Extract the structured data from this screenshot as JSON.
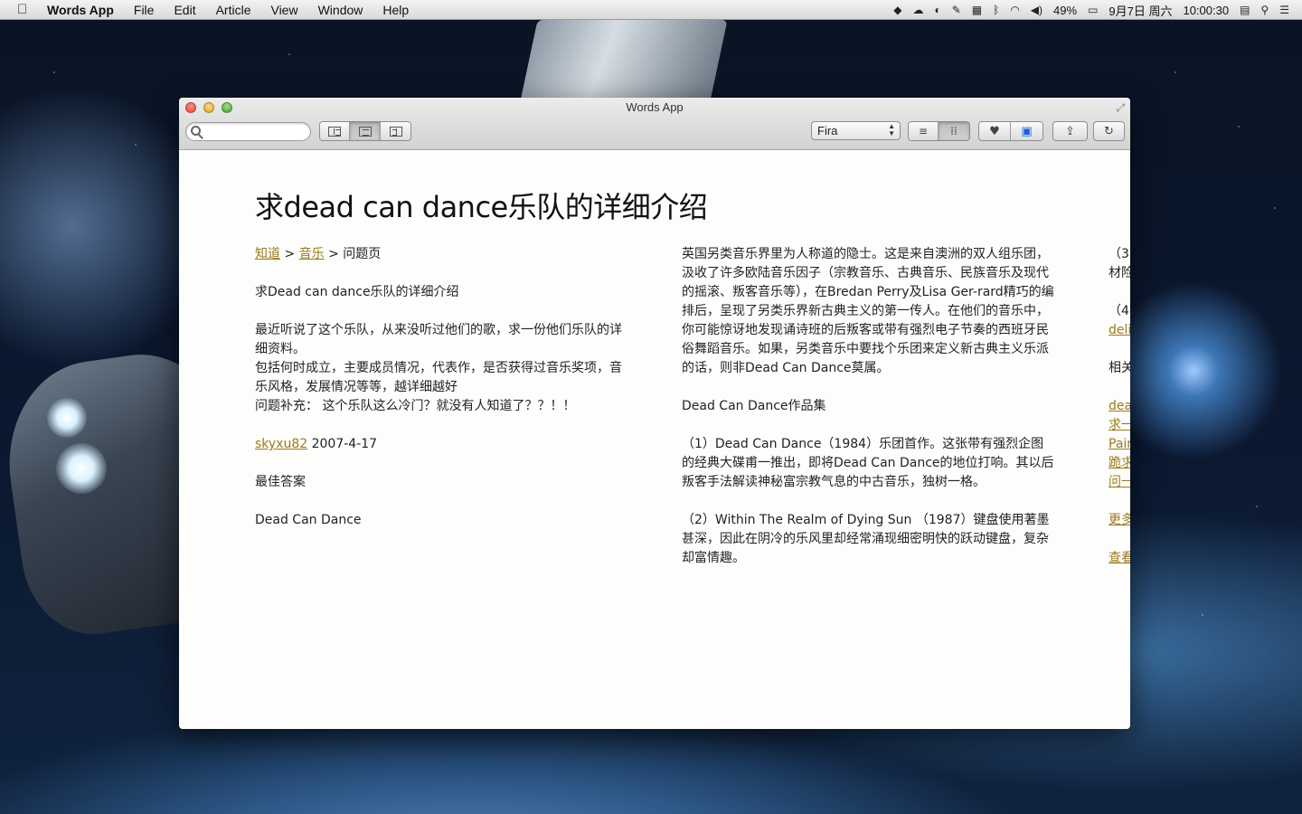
{
  "menubar": {
    "app_name": "Words App",
    "items": [
      "File",
      "Edit",
      "Article",
      "View",
      "Window",
      "Help"
    ],
    "battery": "49%",
    "date": "9月7日 周六",
    "time": "10:00:30"
  },
  "window": {
    "title": "Words App",
    "search": {
      "value": "",
      "placeholder": ""
    },
    "font_select": "Fira"
  },
  "article": {
    "title": "求dead can dance乐队的详细介绍",
    "col1": {
      "breadcrumb": {
        "link1": "知道",
        "sep1": " > ",
        "link2": "音乐",
        "tail": " > 问题页"
      },
      "question_title": "求Dead can dance乐队的详细介绍",
      "q_line1": "最近听说了这个乐队，从来没听过他们的歌，求一份他们乐队的详细资料。",
      "q_line2": "包括何时成立，主要成员情况，代表作，是否获得过音乐奖项，音乐风格，发展情况等等，越详细越好",
      "q_line3": "问题补充： 这个乐队这么冷门？就没有人知道了？？！！",
      "author": "skyxu82",
      "date": " 2007-4-17",
      "best_answer": "最佳答案",
      "band": "Dead Can Dance"
    },
    "col2": {
      "intro": "英国另类音乐界里为人称道的隐士。这是来自澳洲的双人组乐团，汲收了许多欧陆音乐因子（宗教音乐、古典音乐、民族音乐及现代的摇滚、叛客音乐等），在Bredan Perry及Lisa Ger-rard精巧的编排后，呈现了另类乐界新古典主义的第一传人。在他们的音乐中，你可能惊讶地发现诵诗班的后叛客或带有强烈电子节奏的西班牙民俗舞蹈音乐。如果，另类音乐中要找个乐团来定义新古典主义乐派的话，则非Dead Can Dance莫属。",
      "works_heading": "Dead Can Dance作品集",
      "work1": "（1）Dead Can Dance（1984）乐团首作。这张带有强烈企图的经典大碟甫一推出，即将Dead Can Dance的地位打响。其以后叛客手法解读神秘富宗教气息的中古音乐，独树一格。",
      "work2": "（2）Within The Realm of Dying Sun （1987）键盘使用著墨甚深，因此在阴冷的乐风里却经常涌现细密明快的跃动键盘，复杂却富情趣。"
    },
    "col3": {
      "line1": "（3",
      "line2": "材险",
      "line3": "（4",
      "link1": "deli",
      "line4": "相关",
      "link2": "dea",
      "link3": "求一",
      "link4": "Pain",
      "link5": "跪求",
      "link6": "问一",
      "link7": "更多",
      "link8": "查看"
    }
  },
  "colors": {
    "link": "#9a7a1d",
    "page_bg": "#fdfdfb"
  },
  "icons": [
    "apple-icon",
    "dropbox-icon",
    "bluetooth-icon",
    "wifi-icon",
    "volume-icon",
    "battery-icon",
    "flag-icon",
    "spotlight-icon",
    "notification-icon",
    "search-icon",
    "heart-icon",
    "archive-icon",
    "share-icon",
    "refresh-icon",
    "fullscreen-icon"
  ]
}
